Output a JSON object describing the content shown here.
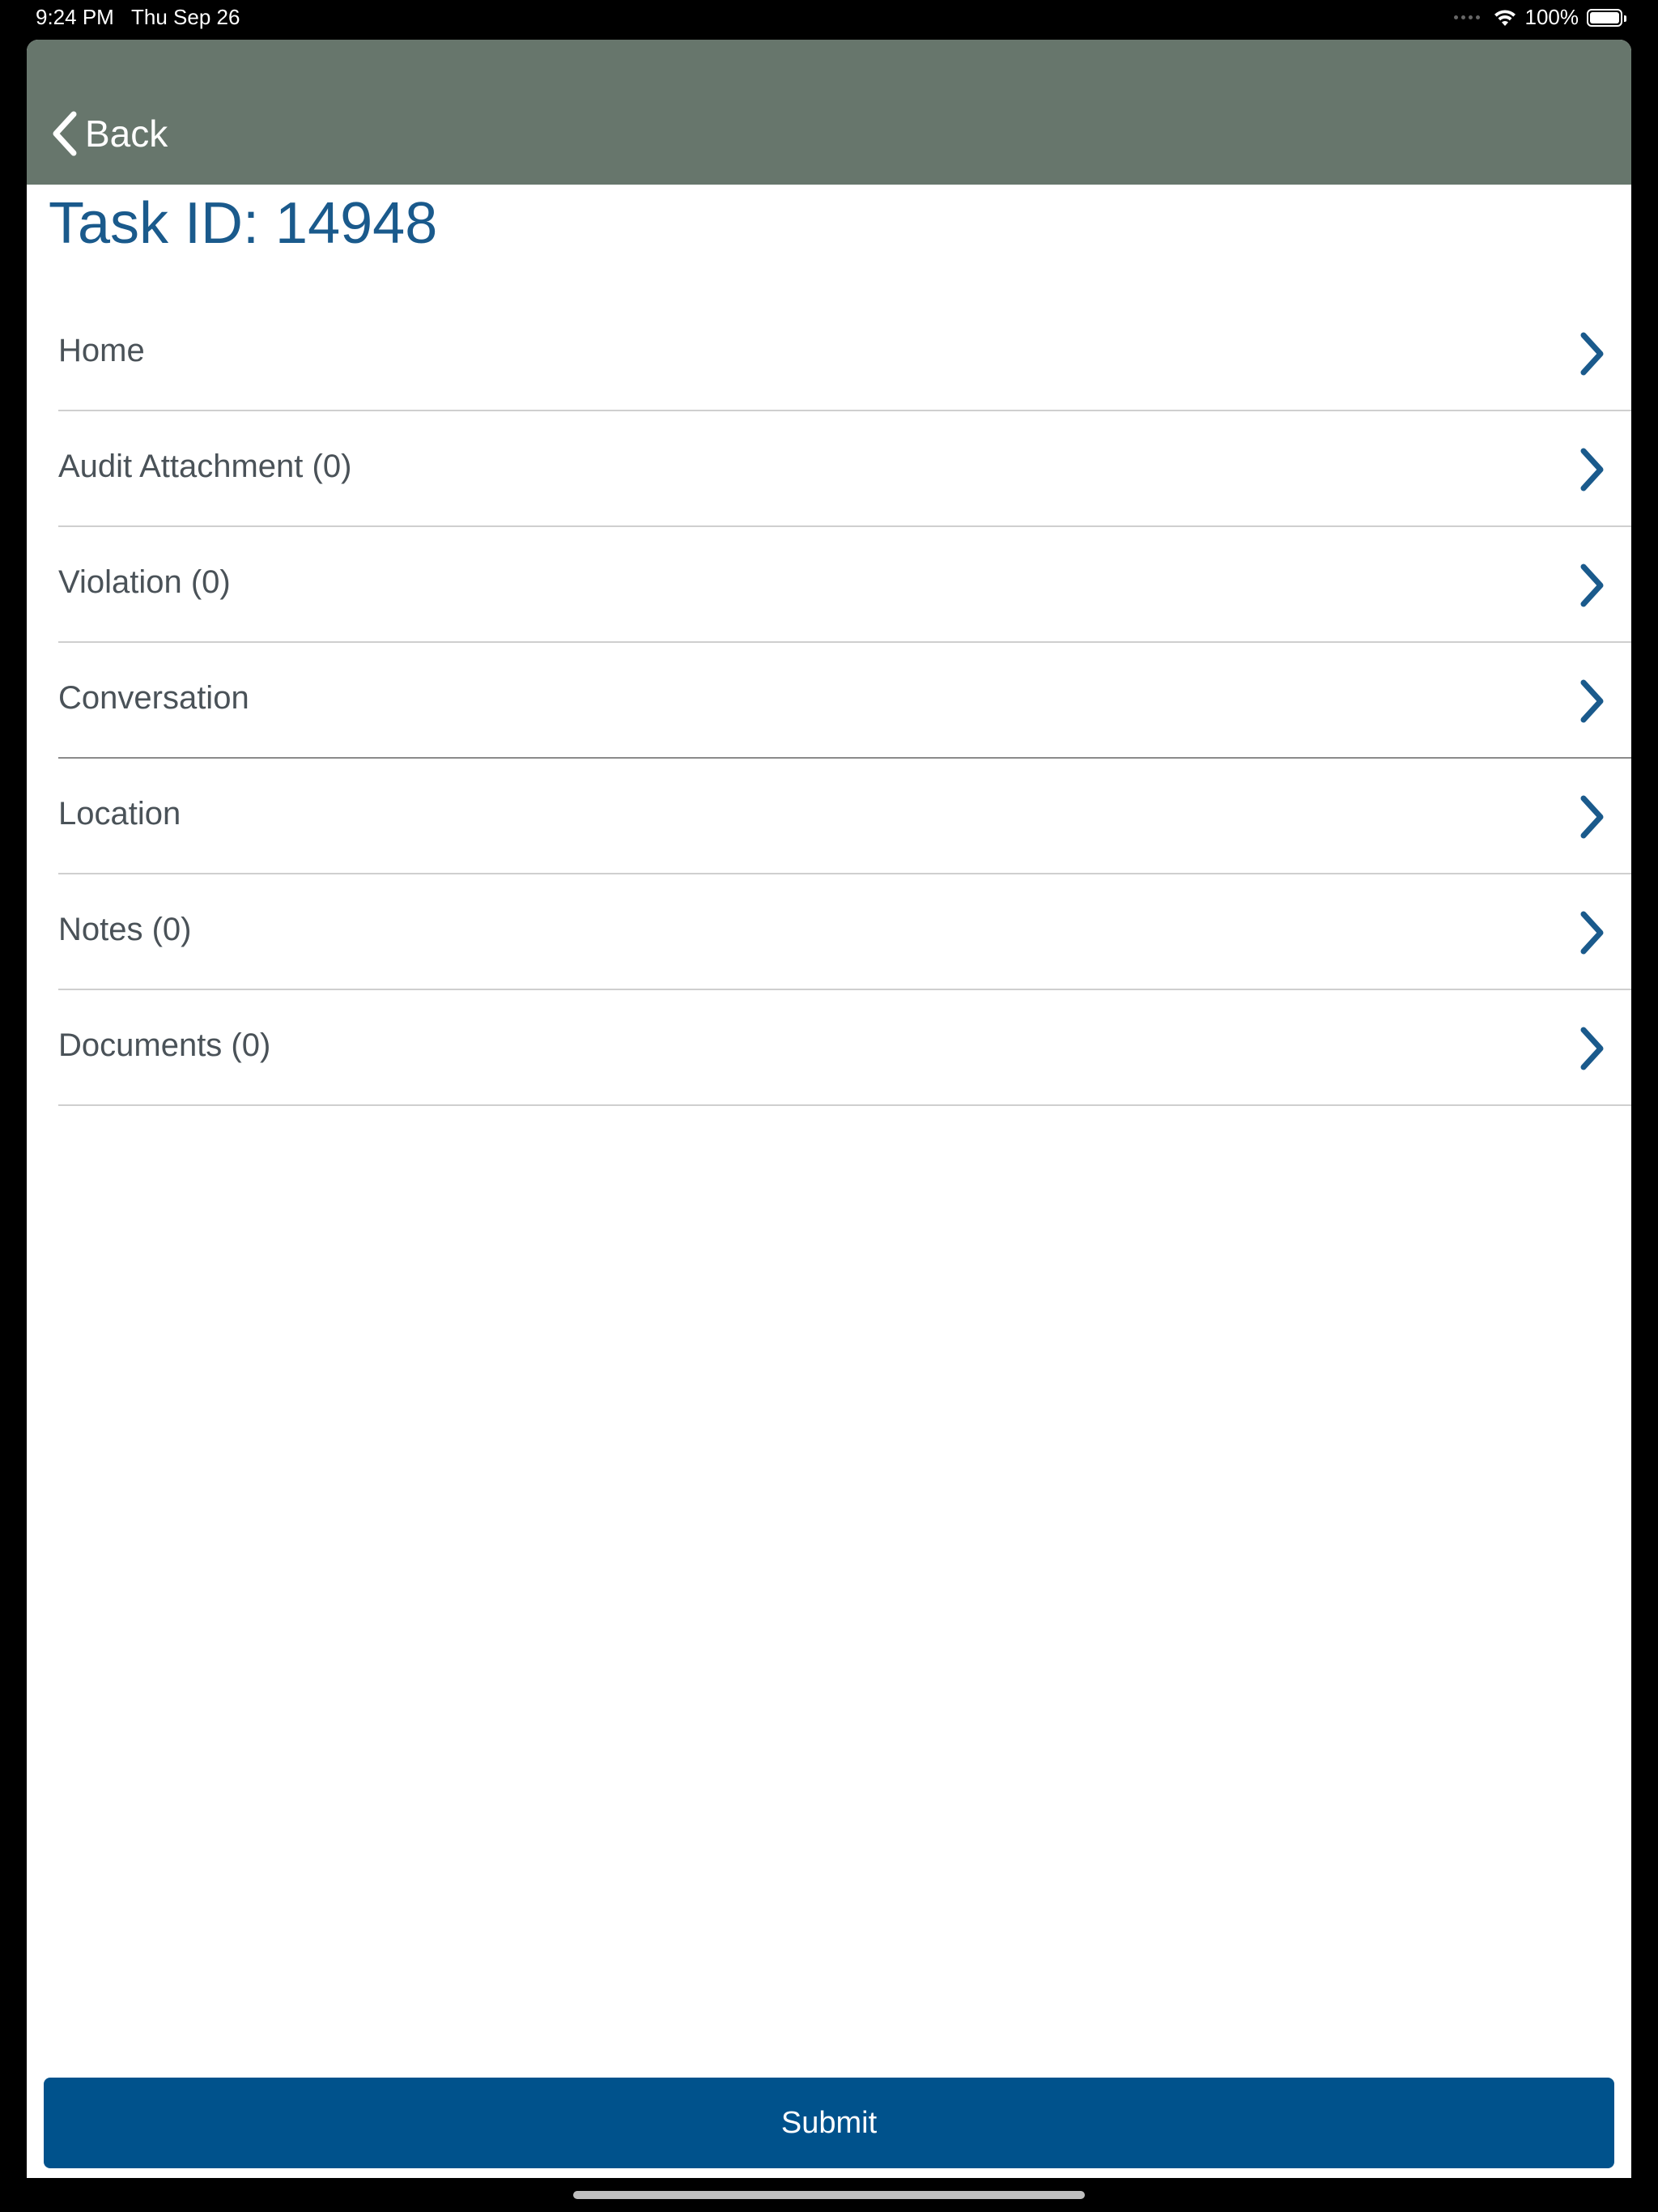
{
  "status_bar": {
    "time": "9:24 PM",
    "date": "Thu Sep 26",
    "battery_percent": "100%",
    "battery_level": 1.0
  },
  "nav": {
    "back_label": "Back"
  },
  "page": {
    "title": "Task ID: 14948"
  },
  "menu": {
    "items": [
      {
        "label": "Home"
      },
      {
        "label": "Audit Attachment (0)"
      },
      {
        "label": "Violation (0)"
      },
      {
        "label": "Conversation"
      },
      {
        "label": "Location"
      },
      {
        "label": "Notes (0)"
      },
      {
        "label": "Documents (0)"
      }
    ]
  },
  "actions": {
    "submit_label": "Submit"
  },
  "colors": {
    "nav_background": "#67766c",
    "title": "#1a5a8c",
    "accent": "#00528c",
    "chevron": "#1a5a8c"
  },
  "icons": {
    "back": "chevron-left-icon",
    "row": "chevron-right-icon",
    "wifi": "wifi-icon",
    "battery": "battery-icon"
  }
}
